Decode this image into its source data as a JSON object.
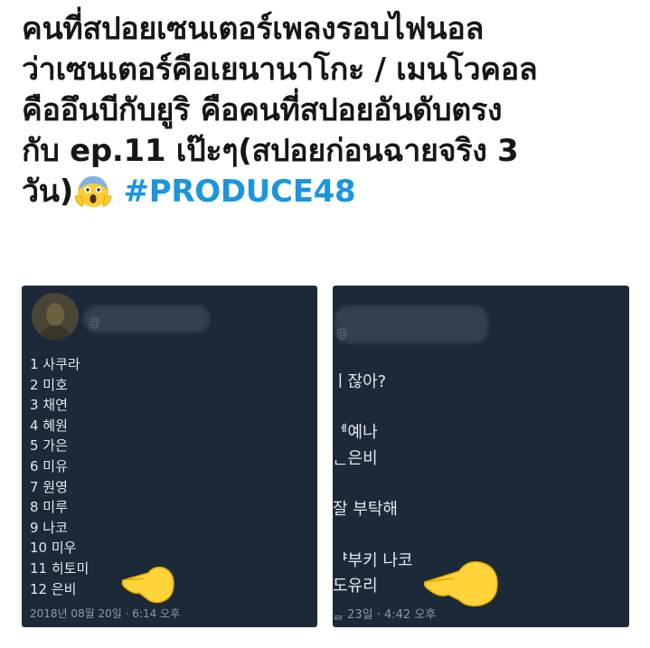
{
  "tweet": {
    "lines": [
      "คนที่สปอยเซนเตอร์เพลงรอบไฟนอล",
      "ว่าเซนเตอร์คือเยนานาโกะ / เมนโวคอล",
      "คืออึนบีกับยูริ คือคนที่สปอยอันดับตรง",
      "กับ ep.11 เป๊ะๆ(สปอยก่อนฉายจริง 3",
      "วัน)"
    ],
    "emoji": "face-screaming-in-fear-icon",
    "hashtag": "#PRODUCE48",
    "colors": {
      "text": "#14171a",
      "hashtag": "#1b95e0"
    }
  },
  "left_card": {
    "handle_fragment": "@",
    "rankings": [
      "1 사쿠라",
      "2 미호",
      "3 채연",
      "4 혜원",
      "5 가은",
      "6 미유",
      "7 원영",
      "8 미루",
      "9 나코",
      "10 미우",
      "11 히토미",
      "12 은비"
    ],
    "timestamp": "2018년 08월 20일 · 6:14 오후",
    "pointer_icon": "pointing-hand-icon"
  },
  "right_card": {
    "handle_fragment": "@",
    "lines": [
      "ㅣ잖아?",
      "ᅦ예나",
      "ᆫ은비",
      "잘 부탁해",
      "ᅣ부키 나코",
      "도유리"
    ],
    "timestamp": "ᆯ 23일 · 4:42 오후",
    "pointer_icon": "pointing-hand-icon"
  },
  "colors": {
    "card_bg": "#1c2938"
  }
}
